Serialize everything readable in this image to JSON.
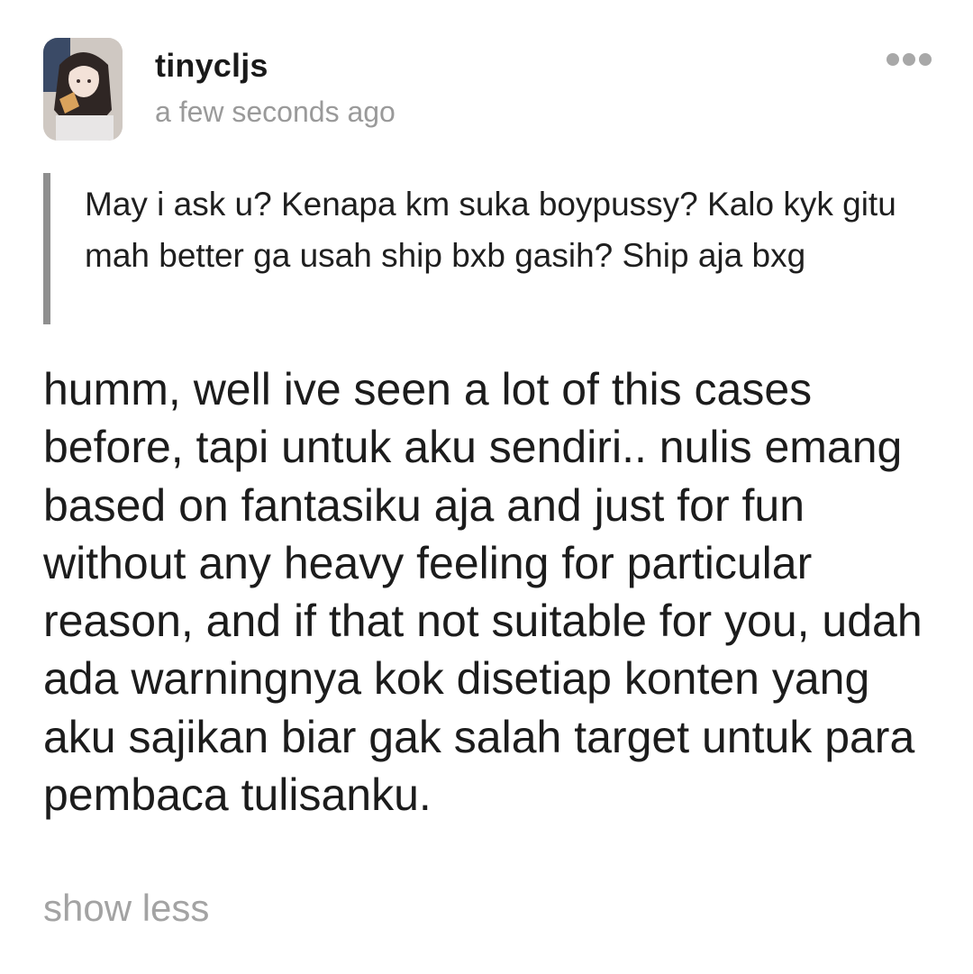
{
  "post": {
    "author": {
      "username": "tinycljs",
      "timestamp": "a few seconds ago",
      "avatar_icon": "profile-photo"
    },
    "menu_icon": "more-horizontal-icon",
    "question": "May i ask u? Kenapa km suka boypussy? Kalo kyk gitu mah better ga usah ship bxb gasih? Ship aja bxg",
    "answer": "humm, well ive seen a lot of this cases before, tapi untuk aku sendiri.. nulis emang based on fantasiku aja and just for fun without any heavy feeling for particular reason, and if that not suitable for you, udah ada warningnya kok disetiap konten yang aku sajikan biar gak salah target untuk para pembaca tulisanku.",
    "show_less_label": "show less"
  },
  "colors": {
    "text": "#1c1c1c",
    "muted": "#9a9a9a",
    "quote_bar": "#8f8f8f"
  }
}
